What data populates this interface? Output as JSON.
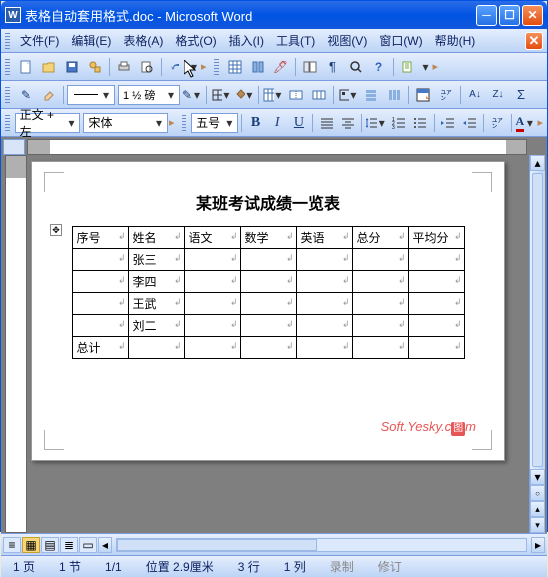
{
  "title": {
    "doc_name": "表格自动套用格式.doc",
    "app_name": "Microsoft Word"
  },
  "menus": {
    "file": "文件(F)",
    "edit": "编辑(E)",
    "table": "表格(A)",
    "format": "格式(O)",
    "insert": "插入(I)",
    "tools": "工具(T)",
    "view": "视图(V)",
    "window": "窗口(W)",
    "help": "帮助(H)"
  },
  "toolbar2": {
    "border_width": "1 ½ 磅"
  },
  "toolbar3": {
    "style": "正文 + 左",
    "font": "宋体",
    "size": "五号",
    "bold": "B",
    "italic": "I",
    "underline": "U",
    "fontcolor": "A"
  },
  "doc": {
    "heading": "某班考试成绩一览表",
    "headers": [
      "序号",
      "姓名",
      "语文",
      "数学",
      "英语",
      "总分",
      "平均分"
    ],
    "rows": [
      [
        "",
        "张三",
        "",
        "",
        "",
        "",
        ""
      ],
      [
        "",
        "李四",
        "",
        "",
        "",
        "",
        ""
      ],
      [
        "",
        "王武",
        "",
        "",
        "",
        "",
        ""
      ],
      [
        "",
        "刘二",
        "",
        "",
        "",
        "",
        ""
      ],
      [
        "总计",
        "",
        "",
        "",
        "",
        "",
        ""
      ]
    ],
    "watermark": "Soft.Yesky.c",
    "watermark_suffix": "图",
    "watermark_end": "m"
  },
  "status": {
    "page": "1 页",
    "section": "1 节",
    "pages": "1/1",
    "position": "位置 2.9厘米",
    "line": "3 行",
    "col": "1 列",
    "rec": "录制",
    "rev": "修订"
  }
}
